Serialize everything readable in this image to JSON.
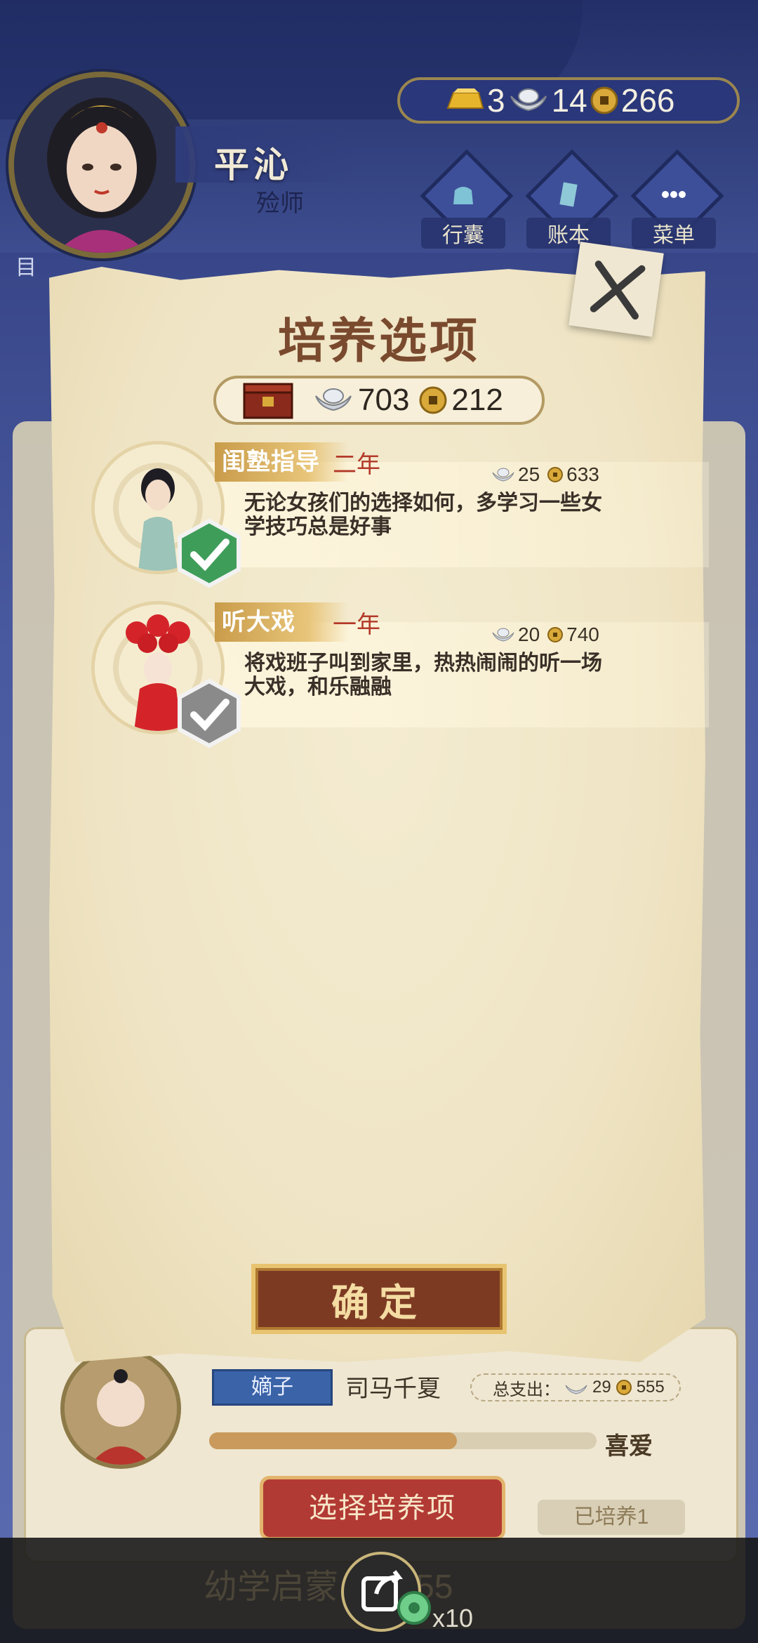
{
  "header": {
    "name": "平沁",
    "title": "殓师"
  },
  "currency": {
    "gold_bars": "3",
    "silver_ingots": "14",
    "coins": "266"
  },
  "menu": [
    {
      "label": "行囊"
    },
    {
      "label": "账本"
    },
    {
      "label": "菜单"
    }
  ],
  "side_tab": {
    "label": "目"
  },
  "modal": {
    "title": "培养选项",
    "resources": {
      "silver": "703",
      "coins": "212"
    },
    "options": [
      {
        "name": "闺塾指导",
        "duration": "二年",
        "cost_silver": "25",
        "cost_coins": "633",
        "description": "无论女孩们的选择如何，多学习一些女学技巧总是好事",
        "selected": true
      },
      {
        "name": "听大戏",
        "duration": "一年",
        "cost_silver": "20",
        "cost_coins": "740",
        "description": "将戏班子叫到家里，热热闹闹的听一场大戏，和乐融融",
        "selected": false
      }
    ],
    "confirm_label": "确定"
  },
  "child_card": {
    "role": "嫡子",
    "name": "司马千夏",
    "total_spend_label": "总支出：",
    "total_silver": "29",
    "total_coins": "555",
    "affection_label": "喜爱",
    "affection_level": 0.64,
    "choose_label": "选择培养项",
    "trained_label": "已培养1"
  },
  "bottom_bar": {
    "ghost_text": "幼学启蒙",
    "ghost_value": "9 555",
    "multiplier": "x10"
  },
  "colors": {
    "accent_brown": "#7a4a2e",
    "duration_red": "#b33a2a",
    "check_green": "#3f9d5a",
    "check_gray": "#8a8a8a"
  }
}
